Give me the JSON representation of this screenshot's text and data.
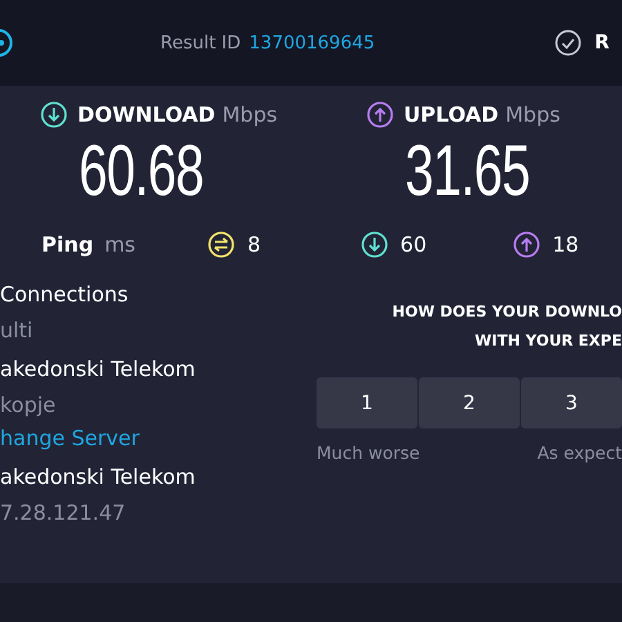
{
  "header": {
    "result_label": "Result ID",
    "result_id": "13700169645",
    "right_text": "R"
  },
  "download": {
    "label": "DOWNLOAD",
    "unit": "Mbps",
    "value": "60.68"
  },
  "upload": {
    "label": "UPLOAD",
    "unit": "Mbps",
    "value": "31.65"
  },
  "ping": {
    "label": "Ping",
    "unit": "ms",
    "idle": "8",
    "download": "60",
    "upload": "18"
  },
  "details": [
    {
      "kind": "title",
      "text": "Connections"
    },
    {
      "kind": "sub",
      "text": "ulti"
    },
    {
      "kind": "title",
      "text": "akedonski Telekom"
    },
    {
      "kind": "sub",
      "text": "kopje"
    },
    {
      "kind": "link",
      "text": "hange Server"
    },
    {
      "kind": "title",
      "text": "akedonski Telekom"
    },
    {
      "kind": "sub",
      "text": "7.28.121.47"
    }
  ],
  "survey": {
    "question_lines": [
      "HOW DOES YOUR DOWNLO",
      "WITH YOUR EXPE"
    ],
    "options": [
      "1",
      "2",
      "3"
    ],
    "scale_labels": [
      "Much worse",
      "As expect"
    ]
  }
}
